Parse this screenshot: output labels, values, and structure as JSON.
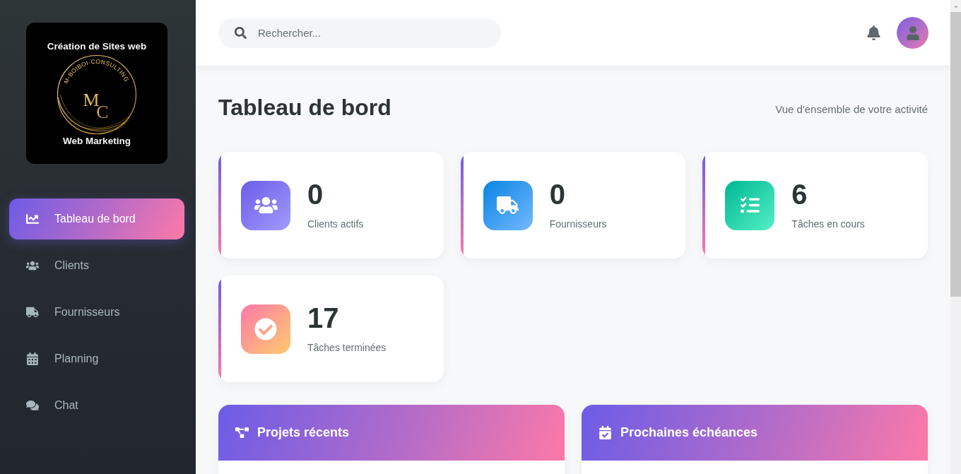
{
  "sidebar": {
    "logo": {
      "top_text": "Création de Sites web",
      "monogram": "MC",
      "ring_text": "M-BOIBOI-CONSULTING",
      "bottom_text": "Web Marketing"
    },
    "nav": [
      {
        "kind": "chart",
        "label": "Tableau de bord",
        "selected": true
      },
      {
        "kind": "users",
        "label": "Clients",
        "selected": false
      },
      {
        "kind": "truck",
        "label": "Fournisseurs",
        "selected": false
      },
      {
        "kind": "calendar",
        "label": "Planning",
        "selected": false
      },
      {
        "kind": "chat",
        "label": "Chat",
        "selected": false
      }
    ]
  },
  "header": {
    "search": {
      "placeholder": "Rechercher..."
    }
  },
  "page": {
    "title": "Tableau de bord",
    "subtitle": "Vue d'ensemble de votre activité"
  },
  "stats": [
    {
      "kind": "clients",
      "value": "0",
      "label": "Clients actifs"
    },
    {
      "kind": "suppliers",
      "value": "0",
      "label": "Fournisseurs"
    },
    {
      "kind": "tasks",
      "value": "6",
      "label": "Tâches en cours"
    },
    {
      "kind": "done",
      "value": "17",
      "label": "Tâches terminées"
    }
  ],
  "panels": [
    {
      "kind": "projects",
      "title": "Projets récents"
    },
    {
      "kind": "deadlines",
      "title": "Prochaines échéances"
    }
  ]
}
